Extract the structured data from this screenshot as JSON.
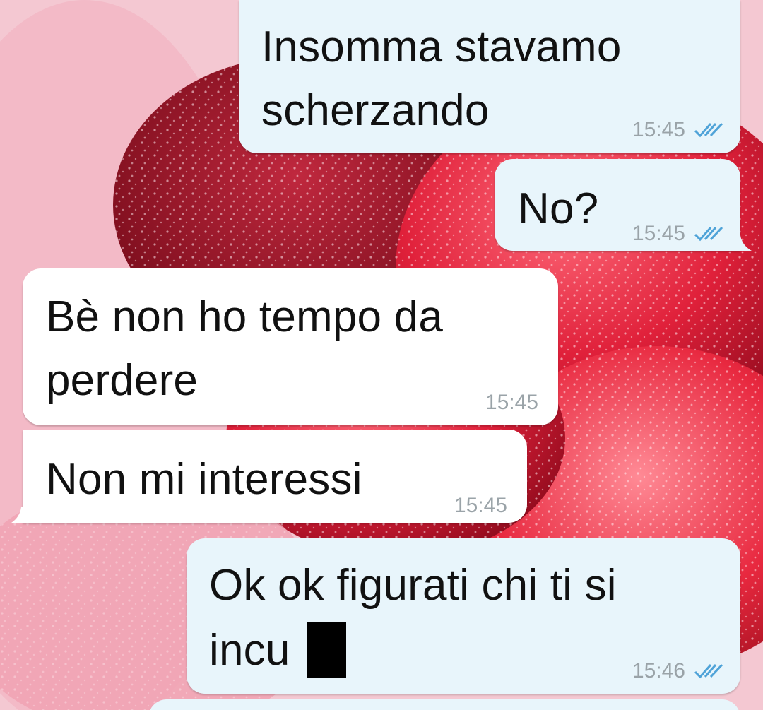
{
  "chat": {
    "background_description_colors": {
      "outgoing_bubble": "#e8f5fb",
      "incoming_bubble": "#ffffff",
      "read_ticks": "#4fa3d8",
      "time_text": "#9aa3a8"
    },
    "messages": [
      {
        "direction": "outgoing",
        "lines": [
          "Insomma stavamo",
          "scherzando"
        ],
        "time": "15:45",
        "status_icon": "double-check-read-icon"
      },
      {
        "direction": "outgoing",
        "lines": [
          "No?"
        ],
        "time": "15:45",
        "status_icon": "double-check-read-icon"
      },
      {
        "direction": "incoming",
        "lines": [
          "Bè non ho tempo da",
          "perdere"
        ],
        "time": "15:45"
      },
      {
        "direction": "incoming",
        "lines": [
          "Non mi interessi"
        ],
        "time": "15:45"
      },
      {
        "direction": "outgoing",
        "lines": [
          "Ok ok figurati chi ti si",
          "incu"
        ],
        "time": "15:46",
        "status_icon": "double-check-read-icon",
        "redacted": true
      }
    ]
  }
}
